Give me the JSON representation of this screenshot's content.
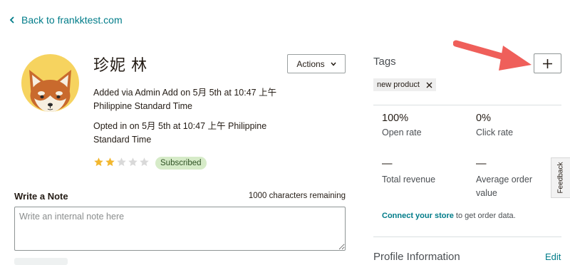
{
  "back_link": {
    "label": "Back to frankktest.com"
  },
  "contact": {
    "name": "珍妮 林",
    "added_text": "Added via Admin Add on 5月 5th at 10:47 上午 Philippine Standard Time",
    "opted_text": "Opted in on 5月 5th at 10:47 上午 Philippine Standard Time",
    "rating": 2,
    "rating_max": 5,
    "status_badge": "Subscribed",
    "actions_label": "Actions"
  },
  "note": {
    "title": "Write a Note",
    "remaining": "1000 characters remaining",
    "placeholder": "Write an internal note here"
  },
  "tags": {
    "title": "Tags",
    "items": [
      {
        "label": "new product"
      }
    ]
  },
  "stats": {
    "open_rate_value": "100%",
    "open_rate_label": "Open rate",
    "click_rate_value": "0%",
    "click_rate_label": "Click rate",
    "total_revenue_value": "—",
    "total_revenue_label": "Total revenue",
    "avg_order_value": "—",
    "avg_order_label": "Average order value"
  },
  "connect": {
    "link_text": "Connect your store",
    "rest_text": " to get order data."
  },
  "profile": {
    "title": "Profile Information",
    "edit_label": "Edit"
  },
  "feedback_label": "Feedback",
  "colors": {
    "link": "#007c89",
    "arrow": "#ef5f5a",
    "star_filled": "#f2b72f",
    "star_empty": "#d9d9d9",
    "badge_bg": "#d6ebc8",
    "avatar_bg": "#f6d35f"
  }
}
